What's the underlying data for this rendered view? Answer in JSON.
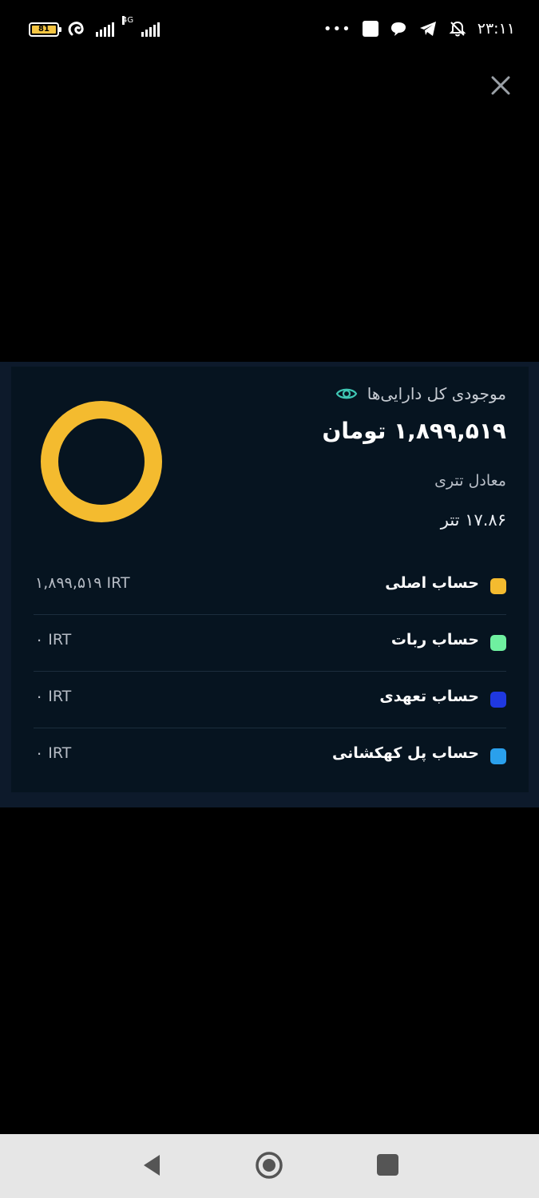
{
  "status_bar": {
    "battery_level": "81",
    "network_type": "4G",
    "overflow_indicator": "•••",
    "time": "۲۳:۱۱"
  },
  "summary": {
    "title": "موجودی کل دارایی‌ها",
    "total_amount": "۱,۸۹۹,۵۱۹ تومان",
    "tether_label": "معادل تتری",
    "tether_value": "۱۷.۸۶ تتر"
  },
  "donut": {
    "color": "#f4bb2f"
  },
  "accounts": [
    {
      "name": "حساب اصلی",
      "value": "۱,۸۹۹,۵۱۹ IRT",
      "color": "#f4bb2f"
    },
    {
      "name": "حساب ربات",
      "value": "۰ IRT",
      "color": "#6ff0a0"
    },
    {
      "name": "حساب تعهدی",
      "value": "۰ IRT",
      "color": "#1f38e0"
    },
    {
      "name": "حساب پل کهکشانی",
      "value": "۰ IRT",
      "color": "#2aa0ec"
    }
  ],
  "colors": {
    "background": "#000000",
    "panel": "#061420",
    "panel_border": "#0d1a2b",
    "eye_icon": "#3fc7b4",
    "nav_bar": "#e6e6e6"
  },
  "icons": {
    "close": "close-icon",
    "eye": "eye-icon",
    "back": "back-triangle-icon",
    "home": "home-circle-icon",
    "recent": "recent-square-icon"
  }
}
